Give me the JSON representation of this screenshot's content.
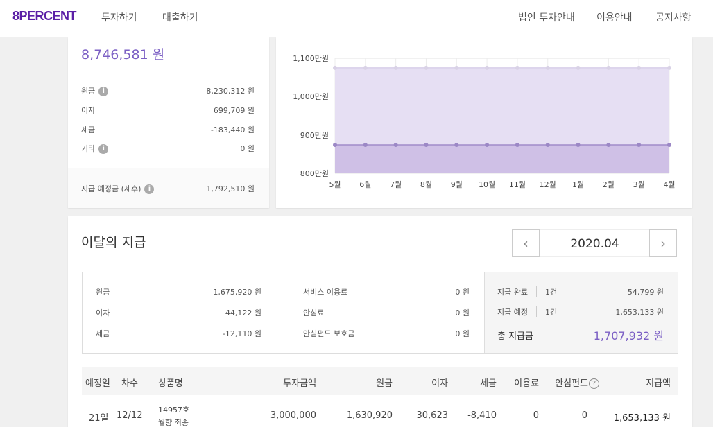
{
  "header": {
    "logo": "8PERCENT",
    "nav_left": [
      "투자하기",
      "대출하기"
    ],
    "nav_right": [
      "법인 투자안내",
      "이용안내",
      "공지사항"
    ]
  },
  "summary": {
    "total": "8,746,581 원",
    "rows": [
      {
        "label": "원금",
        "value": "8,230,312 원"
      },
      {
        "label": "이자",
        "value": "699,709 원"
      },
      {
        "label": "세금",
        "value": "-183,440 원"
      },
      {
        "label": "기타",
        "value": "0 원"
      }
    ],
    "expected_label": "지급 예정금 (세후)",
    "expected_value": "1,792,510 원",
    "info_icon_glyph": "i"
  },
  "chart_data": {
    "type": "area",
    "categories": [
      "5월",
      "6월",
      "7월",
      "8월",
      "9월",
      "10월",
      "11월",
      "12월",
      "1월",
      "2월",
      "3월",
      "4월"
    ],
    "y_ticks": [
      "1,100만원",
      "1,000만원",
      "900만원",
      "800만원"
    ],
    "ylim": [
      800,
      1100
    ],
    "y_unit": "만원",
    "series": [
      {
        "values": [
          1075,
          1075,
          1075,
          1075,
          1075,
          1075,
          1075,
          1075,
          1075,
          1075,
          1075,
          1075
        ],
        "color": "#e6dff3"
      },
      {
        "values": [
          874,
          874,
          874,
          874,
          874,
          874,
          874,
          874,
          874,
          874,
          874,
          874
        ],
        "color": "#cfc0e6"
      }
    ],
    "grid": true
  },
  "month": {
    "title": "이달의 지급",
    "date": "2020.04",
    "prev_glyph": "‹",
    "next_glyph": "›",
    "col1": [
      {
        "label": "원금",
        "value": "1,675,920 원"
      },
      {
        "label": "이자",
        "value": "44,122 원"
      },
      {
        "label": "세금",
        "value": "-12,110 원"
      }
    ],
    "col2": [
      {
        "label": "서비스 이용료",
        "value": "0 원"
      },
      {
        "label": "안심료",
        "value": "0 원"
      },
      {
        "label": "안심펀드 보호금",
        "value": "0 원"
      }
    ],
    "col3": [
      {
        "label": "지급 완료",
        "count": "1건",
        "value": "54,799 원"
      },
      {
        "label": "지급 예정",
        "count": "1건",
        "value": "1,653,133 원"
      }
    ],
    "total_label": "총 지급금",
    "total_value": "1,707,932 원"
  },
  "table": {
    "headers": [
      "예정일",
      "차수",
      "상품명",
      "투자금액",
      "원금",
      "이자",
      "세금",
      "이용료",
      "안심펀드",
      "지급액"
    ],
    "help_glyph": "?",
    "row": {
      "date": "21일",
      "round": "12/12",
      "product_line1": "14957호",
      "product_line2": "월향 최종",
      "invest": "3,000,000",
      "principal": "1,630,920",
      "interest": "30,623",
      "tax": "-8,410",
      "fee": "0",
      "fund": "0",
      "payout": "1,653,133 원"
    }
  },
  "colors": {
    "brand": "#5b1fa6",
    "accent": "#7b5fc4"
  }
}
